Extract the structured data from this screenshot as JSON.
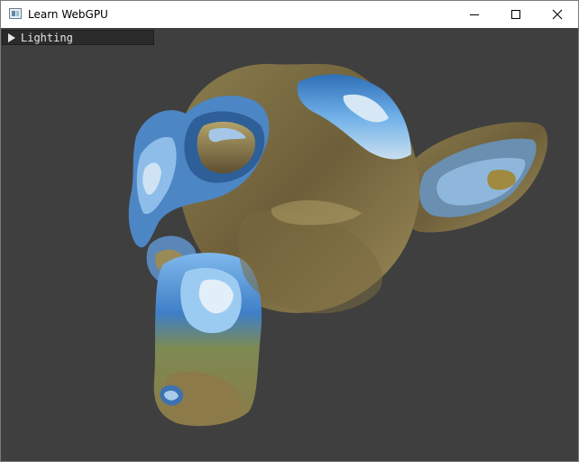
{
  "window": {
    "title": "Learn WebGPU",
    "icon": "app-window-icon",
    "controls": {
      "minimize_icon": "minimize-icon",
      "maximize_icon": "maximize-icon",
      "close_icon": "close-icon"
    }
  },
  "panel": {
    "header_label": "Lighting",
    "header_icon": "triangle-right-icon",
    "collapsed": true
  },
  "scene": {
    "object": "monkey-head-icon",
    "background_color": "#3f3f3f",
    "material": "reflective environment map"
  }
}
